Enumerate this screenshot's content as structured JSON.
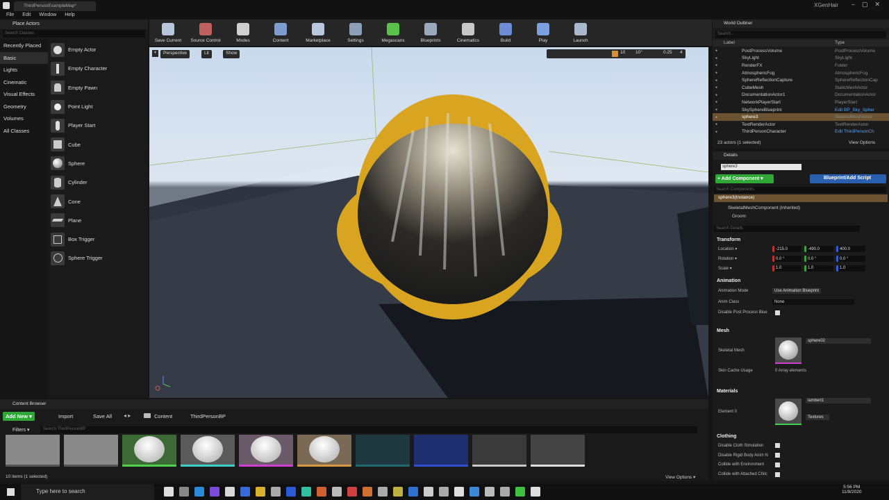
{
  "titlebar": {
    "tab": "ThirdPersonExampleMap*",
    "project": "XGenHair"
  },
  "menu": [
    "File",
    "Edit",
    "Window",
    "Help"
  ],
  "place_actors": {
    "title": "Place Actors",
    "search_placeholder": "Search Classes",
    "categories": [
      "Recently Placed",
      "Basic",
      "Lights",
      "Cinematic",
      "Visual Effects",
      "Geometry",
      "Volumes",
      "All Classes"
    ],
    "selected_category": "Basic",
    "actors": [
      "Empty Actor",
      "Empty Character",
      "Empty Pawn",
      "Point Light",
      "Player Start",
      "Cube",
      "Sphere",
      "Cylinder",
      "Cone",
      "Plane",
      "Box Trigger",
      "Sphere Trigger"
    ]
  },
  "toolbar": [
    {
      "label": "Save Current",
      "color": "#b8c6dc"
    },
    {
      "label": "Source Control",
      "color": "#c06060"
    },
    {
      "label": "Modes",
      "color": "#d0d0d0"
    },
    {
      "label": "Content",
      "color": "#7d9ccf"
    },
    {
      "label": "Marketplace",
      "color": "#b9c8de"
    },
    {
      "label": "Settings",
      "color": "#8ea0b8"
    },
    {
      "label": "Megascans",
      "color": "#5bc14a"
    },
    {
      "label": "Blueprints",
      "color": "#9aa8bb"
    },
    {
      "label": "Cinematics",
      "color": "#c8c8c8"
    },
    {
      "label": "Build",
      "color": "#6e8dd6"
    },
    {
      "label": "Play",
      "color": "#7aa0e0"
    },
    {
      "label": "Launch",
      "color": "#a9b8cc"
    }
  ],
  "viewport": {
    "perspective": "Perspective",
    "lit": "Lit",
    "show": "Show",
    "grid": "10",
    "angle": "10°",
    "scale": "0.25",
    "cams": "4"
  },
  "outliner": {
    "title": "World Outliner",
    "search_placeholder": "Search...",
    "col_label": "Label",
    "col_type": "Type",
    "rows": [
      {
        "label": "PostProcessVolume",
        "type": "PostProcessVolume"
      },
      {
        "label": "SkyLight",
        "type": "SkyLight"
      },
      {
        "label": "RenderFX",
        "type": "Folder"
      },
      {
        "label": "AtmosphericFog",
        "type": "AtmosphericFog"
      },
      {
        "label": "SphereReflectionCapture",
        "type": "SphereReflectionCap"
      },
      {
        "label": "CubeMesh",
        "type": "StaticMeshActor"
      },
      {
        "label": "DocumentationActor1",
        "type": "DocumentationActor"
      },
      {
        "label": "NetworkPlayerStart",
        "type": "PlayerStart"
      },
      {
        "label": "SkySphereBlueprint",
        "type": "Edit BP_Sky_Spher"
      },
      {
        "label": "sphere3",
        "type": "SkeletalMeshActor"
      },
      {
        "label": "TextRenderActor",
        "type": "TextRenderActor"
      },
      {
        "label": "ThirdPersonCharacter",
        "type": "Edit ThirdPersonCh"
      }
    ],
    "status": "23 actors (1 selected)",
    "view_options": "View Options"
  },
  "details": {
    "title": "Details",
    "name": "sphere3",
    "add_component": "+ Add Component ▾",
    "blueprint": "Blueprint/Add Script",
    "search_components": "Search Components",
    "instance": "sphere3(Instance)",
    "component": "SkeletalMeshComponent (Inherited)",
    "groom": "Groom",
    "search_details": "Search Details",
    "transform": "Transform",
    "location_label": "Location ▾",
    "location": [
      "-215.0",
      "-490.0",
      "400.0"
    ],
    "rotation_label": "Rotation ▾",
    "rotation": [
      "0.0 °",
      "0.0 °",
      "0.0 °"
    ],
    "scale_label": "Scale ▾",
    "scale": [
      "1.0",
      "1.0",
      "1.0"
    ],
    "animation": "Animation",
    "anim_mode_label": "Animation Mode",
    "anim_mode": "Use Animation Blueprint",
    "anim_class_label": "Anim Class",
    "anim_class": "None",
    "disable_pp": "Disable Post Process Blue",
    "mesh": "Mesh",
    "skel_mesh_label": "Skeletal Mesh",
    "skel_mesh": "sphere02",
    "skin_cache_label": "Skin Cache Usage",
    "skin_cache": "0 Array elements",
    "materials": "Materials",
    "element0_label": "Element 0",
    "element0": "lambert1",
    "textures": "Textures",
    "clothing": "Clothing",
    "cloth_props": [
      "Disable Cloth Simulation",
      "Disable Rigid Body Anim N",
      "Collide with Environment",
      "Collide with Attached Chilc"
    ]
  },
  "content_browser": {
    "title": "Content Browser",
    "add_new": "Add New ▾",
    "import": "Import",
    "save_all": "Save All",
    "path": [
      "Content",
      "ThirdPersonBP"
    ],
    "filters": "Filters ▾",
    "search_placeholder": "Search ThirdPersonBP",
    "status": "10 items (1 selected)",
    "view_options": "View Options ▾",
    "thumbs": [
      {
        "bg": "#8a8a8a",
        "bar": "#555555"
      },
      {
        "bg": "#8a8a8a",
        "bar": "#555555"
      },
      {
        "bg": "#3c6a34",
        "bar": "#4fd04f"
      },
      {
        "bg": "#5a5a5a",
        "bar": "#3fd0c8"
      },
      {
        "bg": "#6a5a6a",
        "bar": "#d040d0"
      },
      {
        "bg": "#7a6a55",
        "bar": "#d89a40"
      },
      {
        "bg": "#1e3a40",
        "bar": "#1e6a70"
      },
      {
        "bg": "#1f2f70",
        "bar": "#3050d0"
      },
      {
        "bg": "#3a3a3a",
        "bar": "#c8c8c8"
      },
      {
        "bg": "#444444",
        "bar": "#e0e0e0"
      }
    ]
  },
  "taskbar": {
    "search": "Type here to search",
    "time": "5:56 PM",
    "date": "11/9/2020"
  }
}
